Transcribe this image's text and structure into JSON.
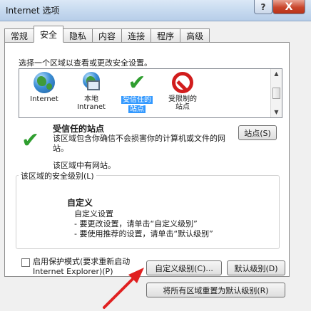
{
  "window": {
    "title": "Internet 选项",
    "help_symbol": "?",
    "close_symbol": "X"
  },
  "tabs": [
    {
      "label": "常规",
      "active": false
    },
    {
      "label": "安全",
      "active": true
    },
    {
      "label": "隐私",
      "active": false
    },
    {
      "label": "内容",
      "active": false
    },
    {
      "label": "连接",
      "active": false
    },
    {
      "label": "程序",
      "active": false
    },
    {
      "label": "高级",
      "active": false
    }
  ],
  "security": {
    "prompt": "选择一个区域以查看或更改安全设置。",
    "zones": [
      {
        "label_line1": "Internet",
        "label_line2": "",
        "icon": "globe-icon",
        "selected": false
      },
      {
        "label_line1": "本地",
        "label_line2": "Intranet",
        "icon": "local-intranet-icon",
        "selected": false
      },
      {
        "label_line1": "受信任的",
        "label_line2": "站点",
        "icon": "checkmark-icon",
        "selected": true
      },
      {
        "label_line1": "受限制的",
        "label_line2": "站点",
        "icon": "no-entry-icon",
        "selected": false
      }
    ],
    "selected_zone": {
      "title": "受信任的站点",
      "description": "该区域包含你确信不会损害你的计算机或文件的网站。",
      "note": "该区域中有网站。",
      "sites_button": "站点(S)"
    },
    "level_group": {
      "title": "该区域的安全级别(L)",
      "level_name": "自定义",
      "line1": "自定义设置",
      "line2": "- 要更改设置，请单击“自定义级别”",
      "line3": "- 要使用推荐的设置，请单击“默认级别”"
    },
    "protected_mode": {
      "label": "启用保护模式(要求重新启动 Internet Explorer)(P)",
      "checked": false
    },
    "buttons": {
      "custom_level": "自定义级别(C)...",
      "default_level": "默认级别(D)",
      "reset_all": "将所有区域重置为默认级别(R)"
    }
  },
  "colors": {
    "annotation_arrow": "#e02020",
    "selection": "#3399ff",
    "check": "#2f9e2f",
    "restricted": "#d11d1d"
  }
}
